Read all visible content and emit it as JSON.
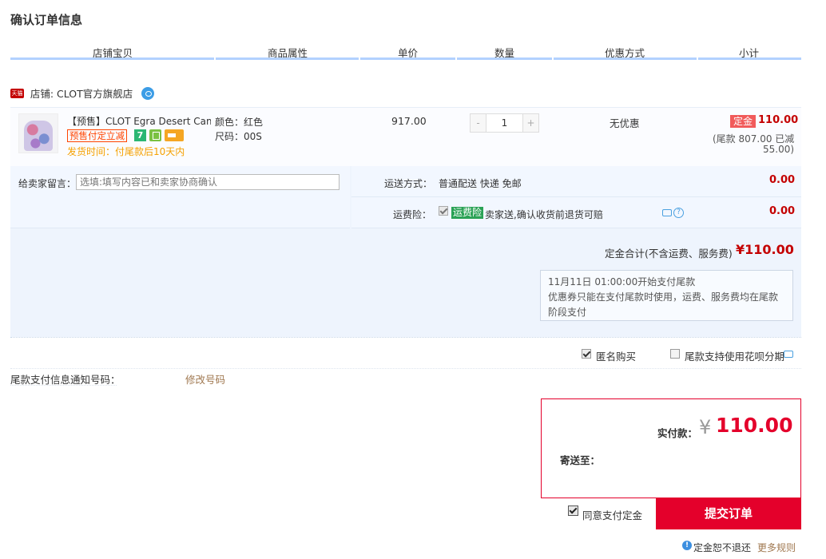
{
  "page": {
    "title": "确认订单信息"
  },
  "table_header": {
    "columns": [
      "店铺宝贝",
      "商品属性",
      "单价",
      "数量",
      "优惠方式",
      "小计"
    ]
  },
  "shop": {
    "logo_text": "天猫",
    "label": "店铺: CLOT官方旗舰店",
    "wangwang_icon": "chat-icon"
  },
  "item": {
    "name": "【预售】CLOT Egra Desert Cam...",
    "presale_badge": "预售付定立减",
    "icon_7": "7",
    "ship_time": "发货时间：付尾款后10天内",
    "color": "颜色：红色",
    "size": "尺码：00S",
    "unit_price": "917.00",
    "quantity": "1",
    "qty_minus": "-",
    "qty_plus": "+",
    "promotion": "无优惠",
    "deposit_tag": "定金",
    "deposit_amount": "110.00",
    "tail_line1": "(尾款 807.00 已减",
    "tail_line2": "55.00)"
  },
  "message": {
    "label": "给卖家留言：",
    "placeholder": "选填:填写内容已和卖家协商确认"
  },
  "shipping": {
    "label": "运送方式：",
    "value": "普通配送 快递 免邮",
    "amount": "0.00"
  },
  "insurance": {
    "label": "运费险：",
    "checked": true,
    "tag": "运费险",
    "text": "卖家送,确认收货前退货可赔",
    "help": "?",
    "amount": "0.00"
  },
  "deposit_total": {
    "label": "定金合计(不含运费、服务费)",
    "amount": "¥110.00"
  },
  "notice": {
    "line1": "11月11日 01:00:00开始支付尾款",
    "line2": "优惠券只能在支付尾款时使用，运费、服务费均在尾款阶段支付"
  },
  "options": {
    "anonymous": {
      "label": "匿名购买",
      "checked": true
    },
    "huabei": {
      "label": "尾款支持使用花呗分期",
      "checked": false
    }
  },
  "notify": {
    "label": "尾款支付信息通知号码：",
    "change_link": "修改号码"
  },
  "payment": {
    "label": "实付款：",
    "currency": "¥",
    "amount": "110.00",
    "send_to_label": "寄送至："
  },
  "agree": {
    "label": "同意支付定金",
    "checked": true
  },
  "submit": {
    "label": "提交订单"
  },
  "refund": {
    "info": "!",
    "label": "定金恕不退还",
    "more_rules": "更多规则"
  },
  "colors": {
    "accent_red": "#e4002b",
    "header_line": "#b2d1ff",
    "panel_bg": "#eef4fd"
  }
}
